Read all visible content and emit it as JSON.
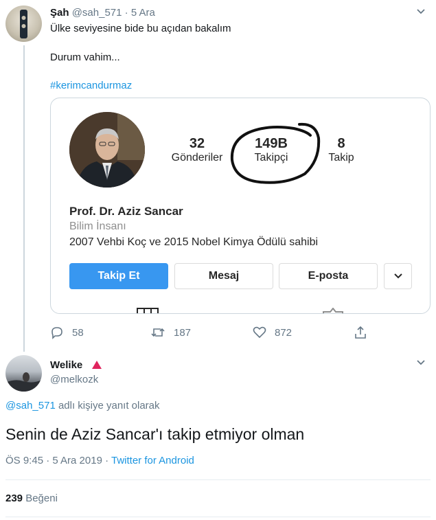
{
  "tweet1": {
    "name": "Şah",
    "handle": "@sah_571",
    "separator": "·",
    "time": "5 Ara",
    "line1": "Ülke seviyesine bide bu açıdan bakalım",
    "line2": "Durum vahim...",
    "hashtag": "#kerimcandurmaz",
    "actions": {
      "replies": "58",
      "retweets": "187",
      "likes": "872"
    }
  },
  "card": {
    "posts_count": "32",
    "posts_label": "Gönderiler",
    "followers_count": "149B",
    "followers_label": "Takipçi",
    "following_count": "8",
    "following_label": "Takip",
    "name": "Prof. Dr. Aziz Sancar",
    "category": "Bilim İnsanı",
    "bio": "2007 Vehbi Koç ve 2015 Nobel Kimya Ödülü sahibi",
    "follow_button": "Takip Et",
    "message_button": "Mesaj",
    "email_button": "E-posta"
  },
  "tweet2": {
    "name": "Welike",
    "handle": "@melkozk",
    "reply_mention": "@sah_571",
    "reply_suffix": " adlı kişiye yanıt olarak",
    "text": "Senin de Aziz Sancar'ı takip etmiyor olman",
    "meta_time": "ÖS 9:45 · 5 Ara 2019 · ",
    "meta_source": "Twitter for Android",
    "likes_count": "239",
    "likes_label": " Beğeni"
  },
  "colors": {
    "link": "#1b95e0",
    "muted": "#657786",
    "follow_btn": "#3897f0"
  }
}
